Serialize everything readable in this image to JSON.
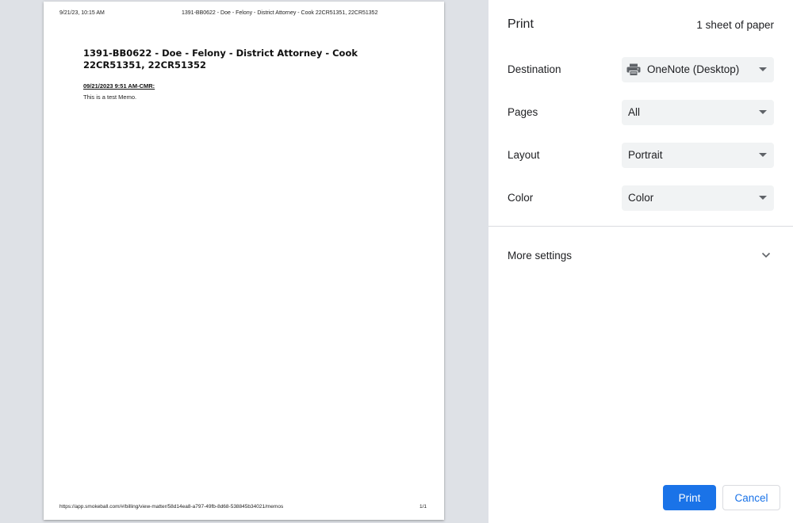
{
  "preview": {
    "header_date": "9/21/23, 10:15 AM",
    "header_title": "1391-BB0622 - Doe - Felony - District Attorney - Cook 22CR51351, 22CR51352",
    "doc_title": "1391-BB0622 - Doe - Felony - District Attorney - Cook 22CR51351, 22CR51352",
    "memo_heading": "09/21/2023 9:51 AM-CMR:",
    "memo_body": "This is a test Memo.",
    "footer_url": "https://app.smokeball.com/#/billing/view-matter/58d14ea8-a797-49fb-8d68-538845b34021/memos",
    "footer_page": "1/1"
  },
  "settings": {
    "title": "Print",
    "sheet_count": "1 sheet of paper",
    "destination": {
      "label": "Destination",
      "value": "OneNote (Desktop)",
      "icon": "printer-icon"
    },
    "pages": {
      "label": "Pages",
      "value": "All"
    },
    "layout": {
      "label": "Layout",
      "value": "Portrait"
    },
    "color": {
      "label": "Color",
      "value": "Color"
    },
    "more_settings": {
      "label": "More settings",
      "icon": "chevron-down-icon"
    },
    "print_button": "Print",
    "cancel_button": "Cancel"
  },
  "colors": {
    "accent": "#1a73e8",
    "preview_background": "#dee1e6",
    "select_background": "#f1f3f4"
  }
}
